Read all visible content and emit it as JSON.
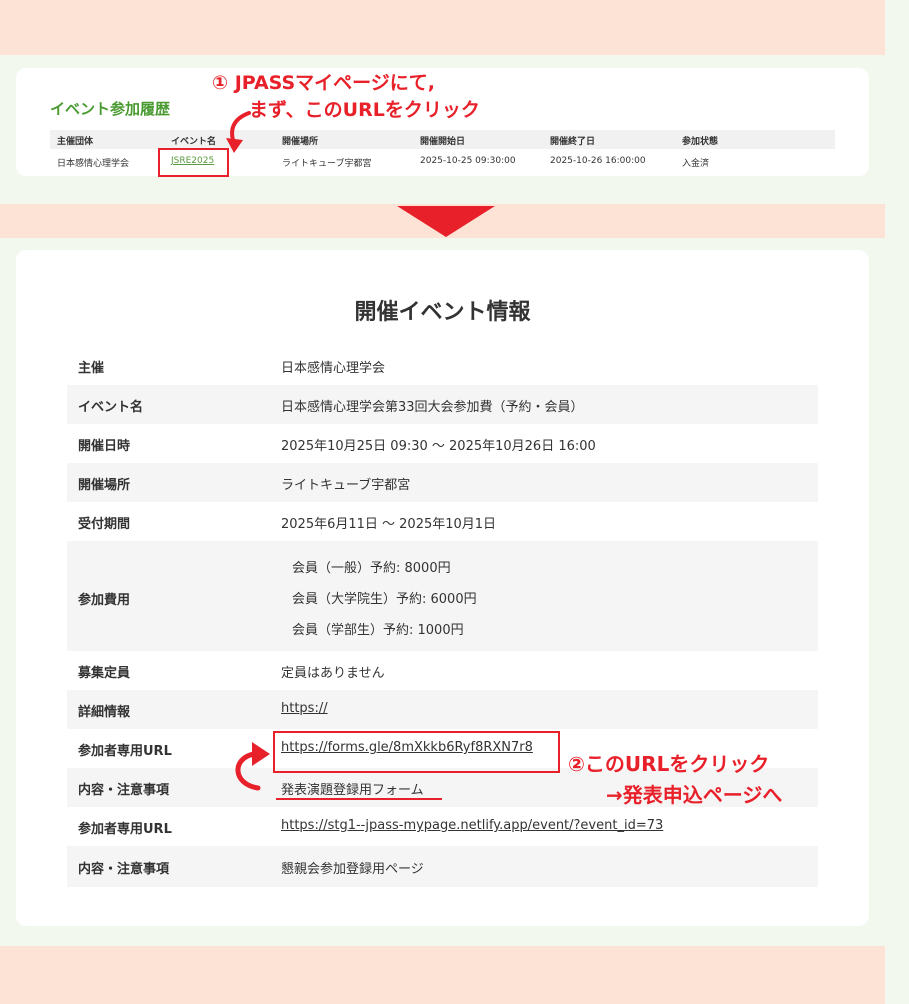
{
  "history": {
    "title": "イベント参加履歴",
    "headers": [
      "主催団体",
      "イベント名",
      "開催場所",
      "開催開始日",
      "開催終了日",
      "参加状態"
    ],
    "row": {
      "organizer": "日本感情心理学会",
      "event_link": "JSRE2025",
      "venue": "ライトキューブ宇都宮",
      "start": "2025-10-25 09:30:00",
      "end": "2025-10-26 16:00:00",
      "status": "入金済"
    }
  },
  "annotations": {
    "step1_line1": "① JPASSマイページにて,",
    "step1_line2": "まず、このURLをクリック",
    "step2_line1": "②このURLをクリック",
    "step2_line2": "→発表申込ページへ",
    "accent_color": "#e8202a"
  },
  "detail": {
    "title": "開催イベント情報",
    "rows": [
      {
        "label": "主催",
        "value": "日本感情心理学会"
      },
      {
        "label": "イベント名",
        "value": "日本感情心理学会第33回大会参加費（予約・会員）"
      },
      {
        "label": "開催日時",
        "value": "2025年10月25日 09:30 〜 2025年10月26日 16:00"
      },
      {
        "label": "開催場所",
        "value": "ライトキューブ宇都宮"
      },
      {
        "label": "受付期間",
        "value": "2025年6月11日 〜 2025年10月1日"
      },
      {
        "label": "参加費用",
        "fees": [
          "会員（一般）予約: 8000円",
          "会員（大学院生）予約: 6000円",
          "会員（学部生）予約: 1000円"
        ]
      },
      {
        "label": "募集定員",
        "value": "定員はありません"
      },
      {
        "label": "詳細情報",
        "value": "https://"
      },
      {
        "label": "参加者専用URL",
        "value": "https://forms.gle/8mXkkb6Ryf8RXN7r8"
      },
      {
        "label": "内容・注意事項",
        "value": "発表演題登録用フォーム"
      },
      {
        "label": "参加者専用URL",
        "value": "https://stg1--jpass-mypage.netlify.app/event/?event_id=73"
      },
      {
        "label": "内容・注意事項",
        "value": "懇親会参加登録用ページ"
      }
    ]
  }
}
